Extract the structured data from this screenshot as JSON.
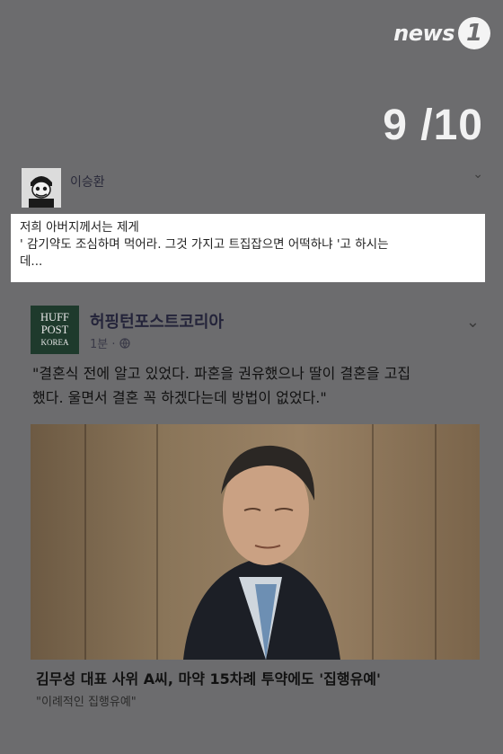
{
  "brand": {
    "word": "news",
    "badge": "1"
  },
  "page_counter": "9 /10",
  "post": {
    "author": "이승환",
    "comment_line1": "저희 아버지께서는 제게",
    "comment_line2": "' 감기약도 조심하며 먹어라. 그것 가지고 트집잡으면 어떡하냐 '고 하시는",
    "comment_line3": "데...",
    "avatar_icon": "cartoon-avatar-icon",
    "chevron_icon": "chevron-down-icon"
  },
  "shared": {
    "logo_lines": [
      "HUFF",
      "POST",
      "KOREA"
    ],
    "page_name": "허핑턴포스트코리아",
    "meta": "1분 · ",
    "globe_icon": "globe-icon",
    "chevron_icon": "chevron-down-icon",
    "quote_line1": "\"결혼식 전에 알고 있었다. 파혼을 권유했으나 딸이 결혼을 고집",
    "quote_line2": "했다. 울면서 결혼 꼭 하겠다는데 방법이 없었다.\"",
    "headline": "김무성 대표 사위 A씨, 마약 15차례 투약에도 '집행유예'",
    "subline": "\"이례적인 집행유예\""
  }
}
